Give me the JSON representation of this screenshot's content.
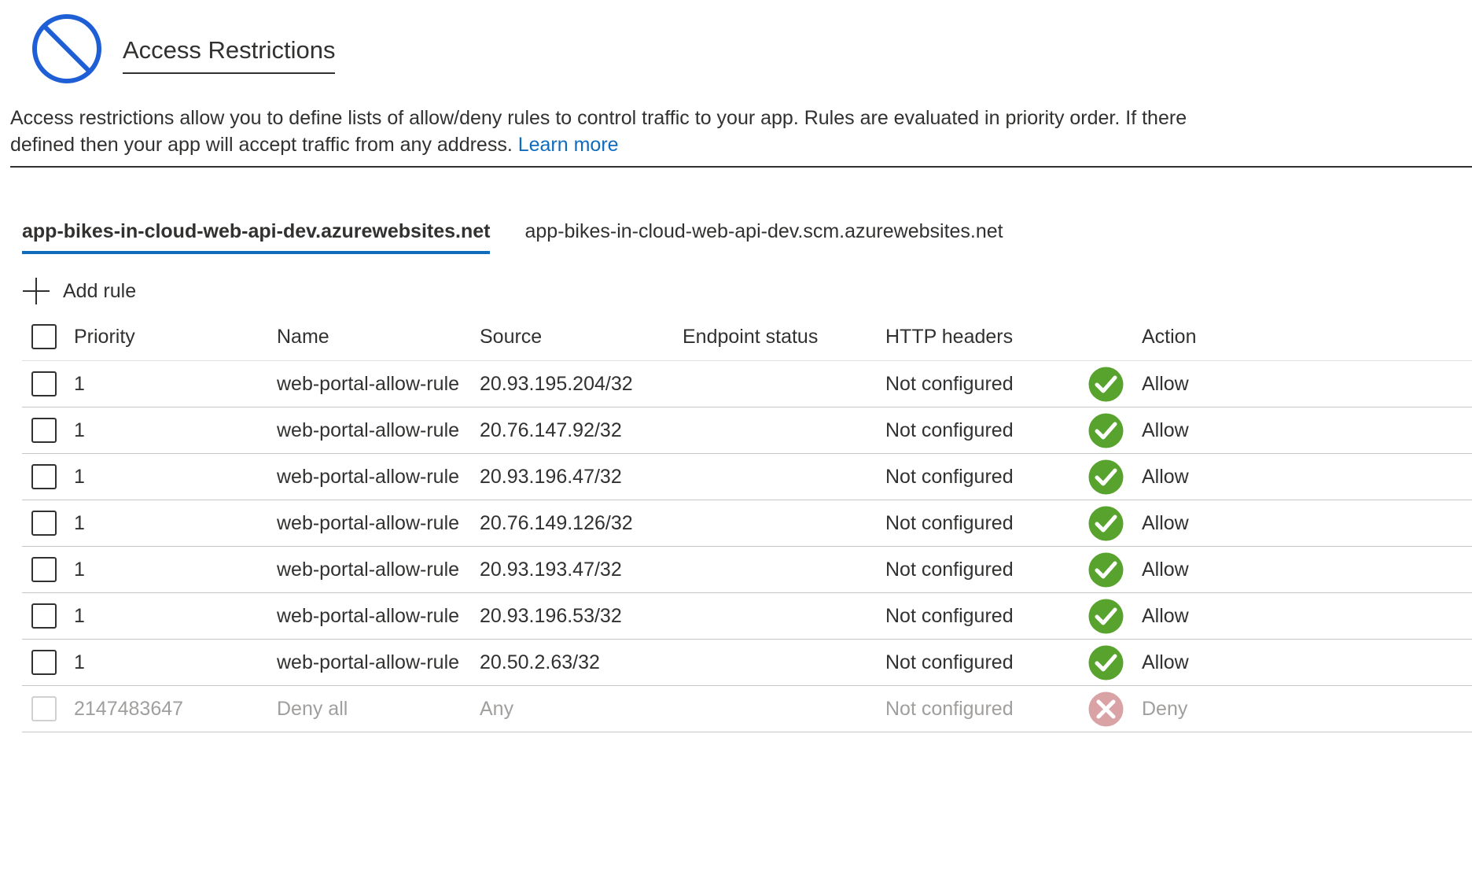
{
  "header": {
    "icon": "blocked-icon",
    "title": "Access Restrictions"
  },
  "description": {
    "line1": "Access restrictions allow you to define lists of allow/deny rules to control traffic to your app. Rules are evaluated in priority order. If there",
    "line2": "defined then your app will accept traffic from any address. ",
    "learn_more": "Learn more"
  },
  "tabs": [
    {
      "label": "app-bikes-in-cloud-web-api-dev.azurewebsites.net",
      "active": true
    },
    {
      "label": "app-bikes-in-cloud-web-api-dev.scm.azurewebsites.net",
      "active": false
    }
  ],
  "toolbar": {
    "add_rule_icon": "plus-icon",
    "add_rule_label": "Add rule"
  },
  "table": {
    "columns": {
      "priority": "Priority",
      "name": "Name",
      "source": "Source",
      "endpoint_status": "Endpoint status",
      "http_headers": "HTTP headers",
      "action": "Action"
    },
    "rows": [
      {
        "priority": "1",
        "name": "web-portal-allow-rule",
        "source": "20.93.195.204/32",
        "endpoint_status": "",
        "http_headers": "Not configured",
        "action": "Allow",
        "status_icon": "check-circle-icon"
      },
      {
        "priority": "1",
        "name": "web-portal-allow-rule",
        "source": "20.76.147.92/32",
        "endpoint_status": "",
        "http_headers": "Not configured",
        "action": "Allow",
        "status_icon": "check-circle-icon"
      },
      {
        "priority": "1",
        "name": "web-portal-allow-rule",
        "source": "20.93.196.47/32",
        "endpoint_status": "",
        "http_headers": "Not configured",
        "action": "Allow",
        "status_icon": "check-circle-icon"
      },
      {
        "priority": "1",
        "name": "web-portal-allow-rule",
        "source": "20.76.149.126/32",
        "endpoint_status": "",
        "http_headers": "Not configured",
        "action": "Allow",
        "status_icon": "check-circle-icon"
      },
      {
        "priority": "1",
        "name": "web-portal-allow-rule",
        "source": "20.93.193.47/32",
        "endpoint_status": "",
        "http_headers": "Not configured",
        "action": "Allow",
        "status_icon": "check-circle-icon"
      },
      {
        "priority": "1",
        "name": "web-portal-allow-rule",
        "source": "20.93.196.53/32",
        "endpoint_status": "",
        "http_headers": "Not configured",
        "action": "Allow",
        "status_icon": "check-circle-icon"
      },
      {
        "priority": "1",
        "name": "web-portal-allow-rule",
        "source": "20.50.2.63/32",
        "endpoint_status": "",
        "http_headers": "Not configured",
        "action": "Allow",
        "status_icon": "check-circle-icon"
      },
      {
        "priority": "2147483647",
        "name": "Deny all",
        "source": "Any",
        "endpoint_status": "",
        "http_headers": "Not configured",
        "action": "Deny",
        "status_icon": "deny-circle-icon",
        "disabled": true
      }
    ]
  },
  "colors": {
    "accent": "#0f6cbd",
    "blocked_icon": "#1f5fd6",
    "allow": "#57a32d",
    "deny": "#d9a3a6",
    "text": "#323130",
    "muted_text": "#a19f9d"
  }
}
